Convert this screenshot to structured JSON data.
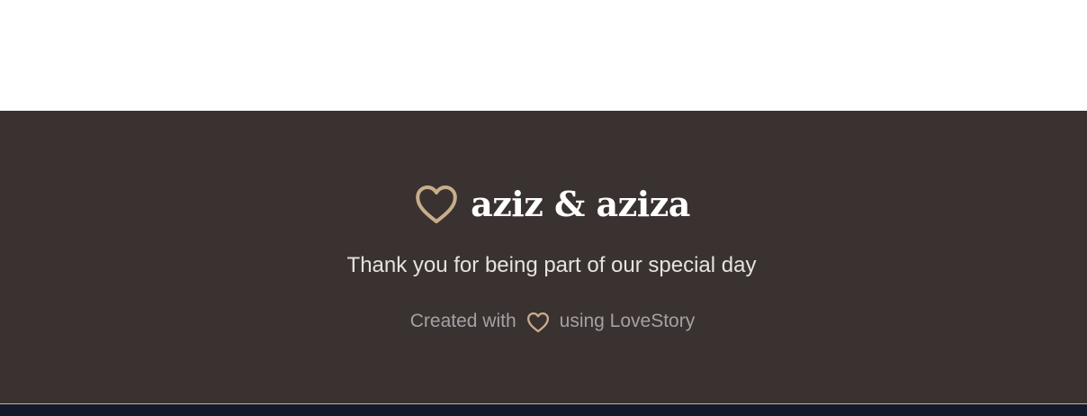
{
  "footer": {
    "brand_name": "aziz & aziza",
    "brand_icon": "heart-outline-icon",
    "thanks_message": "Thank you for being part of our special day",
    "credit_prefix": "Created with",
    "credit_icon": "heart-outline-icon",
    "credit_suffix": "using LoveStory"
  },
  "colors": {
    "footer_background": "#3a3230",
    "accent_heart": "#c8ad8c",
    "brand_text": "#ffffff",
    "thanks_text": "#e6e2df",
    "credit_text": "#a6a0a5",
    "bottom_bar": "#131a2a"
  }
}
